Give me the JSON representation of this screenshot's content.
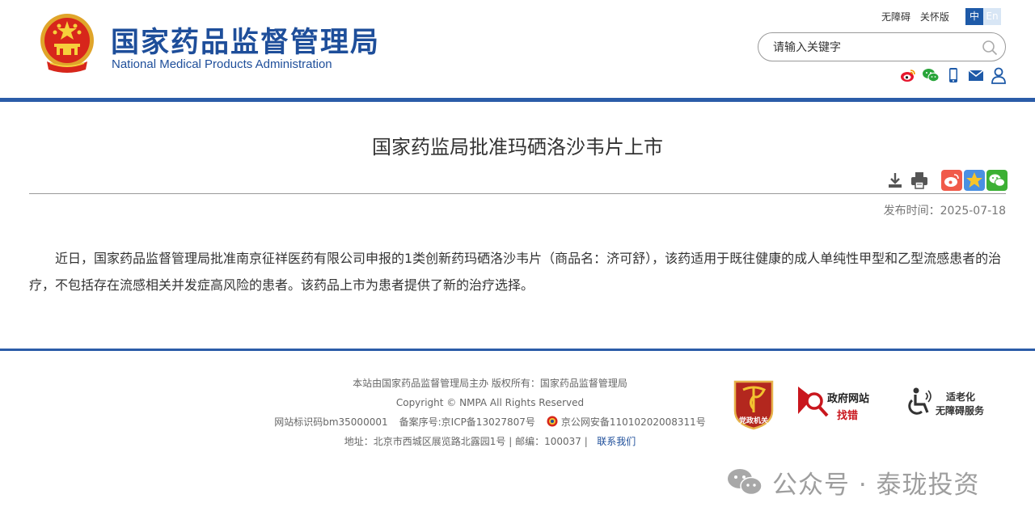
{
  "header": {
    "site_title_cn": "国家药品监督管理局",
    "site_title_en": "National Medical Products Administration",
    "top_links": [
      "无障碍",
      "关怀版"
    ],
    "lang": {
      "zh": "中",
      "en": "En"
    },
    "search": {
      "placeholder": "请输入关键字"
    },
    "social_icons": [
      "weibo-icon",
      "wechat-icon",
      "mobile-icon",
      "mail-icon",
      "user-icon"
    ]
  },
  "article": {
    "title": "国家药监局批准玛硒洛沙韦片上市",
    "pubdate_label": "发布时间：",
    "pubdate_value": "2025-07-18",
    "body": "近日，国家药品监督管理局批准南京征祥医药有限公司申报的1类创新药玛硒洛沙韦片（商品名：济可舒），该药适用于既往健康的成人单纯性甲型和乙型流感患者的治疗，不包括存在流感相关并发症高风险的患者。该药品上市为患者提供了新的治疗选择。"
  },
  "footer": {
    "line1": "本站由国家药品监督管理局主办 版权所有：国家药品监督管理局",
    "line2": "Copyright © NMPA All Rights Reserved",
    "site_id": "网站标识码bm35000001",
    "icp": "备案序号:京ICP备13027807号",
    "police": "京公网安备11010202008311号",
    "address": "地址：北京市西城区展览路北露园1号 | 邮编：100037 |",
    "contact": "联系我们",
    "badge_dangzheng": "党政机关",
    "badge_zf_line1": "政府网站",
    "badge_zf_line2": "找错",
    "badge_old_line1": "适老化",
    "badge_old_line2": "无障碍服务"
  },
  "watermark": {
    "text": "公众号 · 泰珑投资"
  },
  "colors": {
    "brand_blue": "#1e4e9a",
    "rule_blue": "#2b5ca8",
    "emblem_red": "#d7261b",
    "gold": "#f2c230"
  }
}
